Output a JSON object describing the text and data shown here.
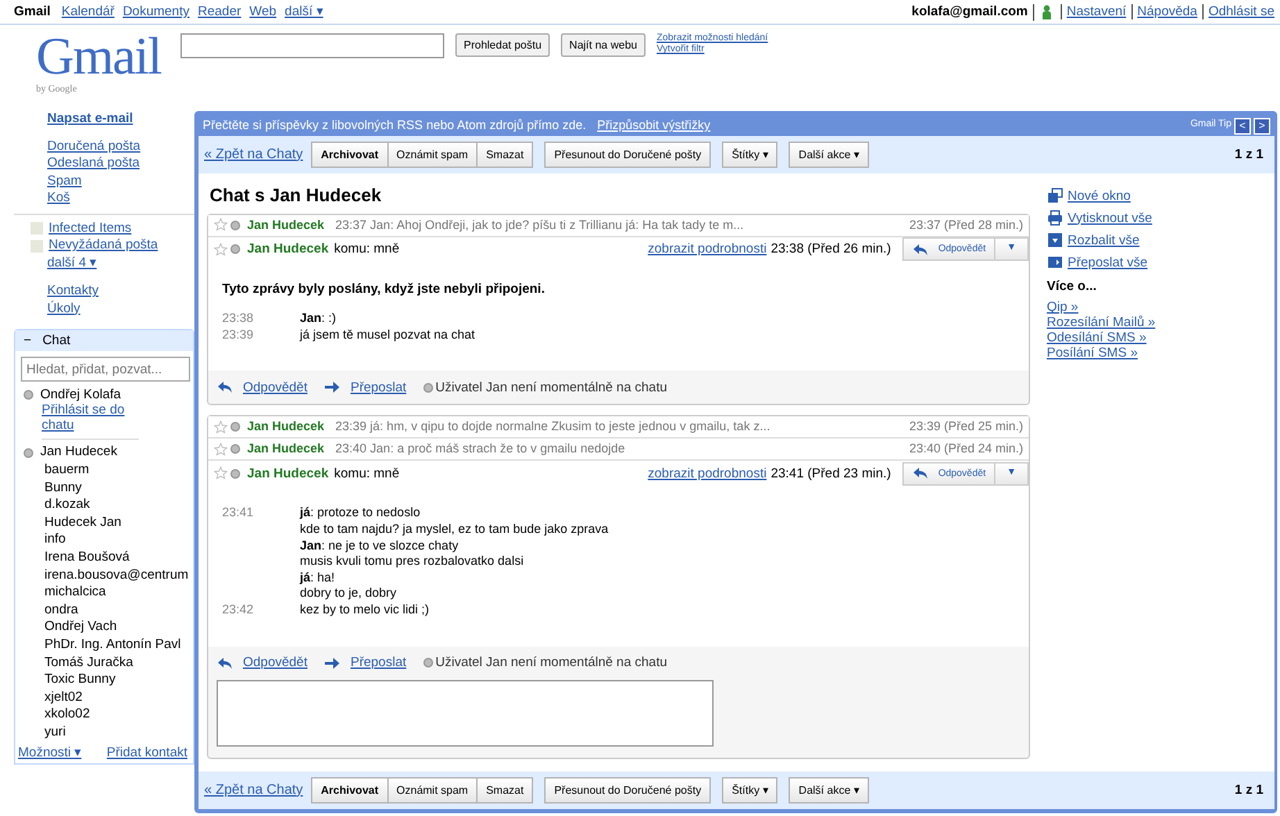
{
  "top_nav": {
    "links": [
      {
        "label": "Gmail",
        "selected": true
      },
      {
        "label": "Kalendář",
        "selected": false
      },
      {
        "label": "Dokumenty",
        "selected": false
      },
      {
        "label": "Reader",
        "selected": false
      },
      {
        "label": "Web",
        "selected": false
      },
      {
        "label": "další ▾",
        "selected": false
      }
    ],
    "account": "kolafa@gmail.com",
    "user_links": [
      "Nastavení",
      "Nápověda",
      "Odhlásit se"
    ]
  },
  "header": {
    "logo": "Gmail",
    "logo_sub": "by Google",
    "search_buttons": [
      "Prohledat poštu",
      "Najít na webu"
    ],
    "search_links": [
      "Zobrazit možnosti hledání",
      "Vytvořit filtr"
    ]
  },
  "sidebar": {
    "compose": "Napsat e-mail",
    "folders": [
      {
        "label": "Doručená pošta"
      },
      {
        "label": "Odeslaná pošta"
      },
      {
        "label": "Spam"
      },
      {
        "label": "Koš"
      }
    ],
    "labels": [
      {
        "label": "Infected Items"
      },
      {
        "label": "Nevyžádaná pošta"
      }
    ],
    "more": "další 4 ▾",
    "links": [
      "Kontakty",
      "Úkoly"
    ],
    "chat": {
      "toggle": "−",
      "title": "Chat",
      "expanded": true,
      "placeholder": "Hledat, přidat, pozvat...",
      "me": "Ondřej Kolafa",
      "sign_in": "Přihlásit se do chatu",
      "contacts": [
        {
          "name": "Jan Hudecek",
          "online": false
        },
        {
          "name": "bauerm"
        },
        {
          "name": "Bunny"
        },
        {
          "name": "d.kozak"
        },
        {
          "name": "Hudecek Jan"
        },
        {
          "name": "info"
        },
        {
          "name": "Irena Boušová"
        },
        {
          "name": "irena.bousova@centrum"
        },
        {
          "name": "michalcica"
        },
        {
          "name": "ondra"
        },
        {
          "name": "Ondřej Vach"
        },
        {
          "name": "PhDr. Ing. Antonín Pavl"
        },
        {
          "name": "Tomáš Juračka"
        },
        {
          "name": "Toxic Bunny"
        },
        {
          "name": "xjelt02"
        },
        {
          "name": "xkolo02"
        },
        {
          "name": "yuri"
        }
      ],
      "options": "Možnosti ▾",
      "add_contact": "Přidat kontakt"
    }
  },
  "tip_bar": {
    "text": "Přečtěte si příspěvky z libovolných RSS nebo Atom zdrojů přímo zde.",
    "link": "Přizpůsobit výstřižky",
    "tip_label": "Gmail Tip",
    "prev": "<",
    "next": ">"
  },
  "toolbar_top": {
    "back": "« Zpět na Chaty",
    "groups": [
      [
        {
          "label": "Archivovat",
          "bold": true
        },
        {
          "label": "Oznámit spam",
          "bold": false
        },
        {
          "label": "Smazat",
          "bold": false
        }
      ],
      [
        {
          "label": "Přesunout do Doručené pošty",
          "bold": false
        }
      ],
      [
        {
          "label": "Štítky ▾",
          "bold": false
        }
      ],
      [
        {
          "label": "Další akce ▾",
          "bold": false
        }
      ]
    ],
    "count": "1 z 1"
  },
  "conversation_title": "Chat s Jan Hudecek",
  "threads": [
    {
      "messages": [
        {
          "kind": "collapsed",
          "starred": false,
          "sender": "Jan Hudecek",
          "snippet": "23:37 Jan: Ahoj Ondřeji, jak to jde? píšu ti z Trillianu já: Ha tak tady te m...",
          "date": "23:37 (Před 28 min.)"
        },
        {
          "kind": "expanded",
          "starred": false,
          "sender": "Jan Hudecek",
          "to": "komu: mně",
          "details": "zobrazit podrobnosti",
          "date": "23:38 (Před 26 min.)",
          "reply": "Odpovědět",
          "menu": "▼",
          "notice": "Tyto zprávy byly poslány, když jste nebyli připojeni.",
          "lines": [
            {
              "time": "23:38",
              "text": "**Jan**: :)"
            },
            {
              "time": "23:39",
              "text": "já jsem tě musel pozvat na chat"
            }
          ]
        }
      ],
      "footer": {
        "reply": "Odpovědět",
        "forward": "Přeposlat",
        "status": "Uživatel Jan není momentálně na chatu"
      },
      "reply_box": false
    },
    {
      "messages": [
        {
          "kind": "collapsed",
          "starred": false,
          "sender": "Jan Hudecek",
          "snippet": "23:39 já: hm, v qipu to dojde normalne Zkusim to jeste jednou v gmailu, tak z...",
          "date": "23:39 (Před 25 min.)"
        },
        {
          "kind": "collapsed",
          "starred": false,
          "sender": "Jan Hudecek",
          "snippet": "23:40 Jan: a proč máš strach že to v gmailu nedojde",
          "date": "23:40 (Před 24 min.)"
        },
        {
          "kind": "expanded",
          "starred": false,
          "sender": "Jan Hudecek",
          "to": "komu: mně",
          "details": "zobrazit podrobnosti",
          "date": "23:41 (Před 23 min.)",
          "reply": "Odpovědět",
          "menu": "▼",
          "lines": [
            {
              "time": "23:41",
              "text": "**já**: protoze to nedoslo"
            },
            {
              "text": "kde to tam najdu? ja myslel, ez to tam bude jako zprava"
            },
            {
              "text": "**Jan**: ne je to ve slozce chaty"
            },
            {
              "text": "musis kvuli tomu pres rozbalovatko dalsi"
            },
            {
              "text": "**já**: ha!"
            },
            {
              "text": "dobry to je, dobry"
            },
            {
              "time": "23:42",
              "text": "kez by to melo vic lidi ;)"
            }
          ]
        }
      ],
      "footer": {
        "reply": "Odpovědět",
        "forward": "Přeposlat",
        "status": "Uživatel Jan není momentálně na chatu"
      },
      "reply_box": true
    }
  ],
  "side_actions": [
    "Nové okno",
    "Vytisknout vše",
    "Rozbalit vše",
    "Přeposlat vše"
  ],
  "more_about": {
    "title": "Více o...",
    "links": [
      "Qip »",
      "Rozesílání Mailů »",
      "Odesílání SMS »",
      "Posílání SMS »"
    ]
  },
  "toolbar_bottom": {
    "back": "« Zpět na Chaty",
    "groups": [
      [
        {
          "label": "Archivovat",
          "bold": true
        },
        {
          "label": "Oznámit spam",
          "bold": false
        },
        {
          "label": "Smazat",
          "bold": false
        }
      ],
      [
        {
          "label": "Přesunout do Doručené pošty",
          "bold": false
        }
      ],
      [
        {
          "label": "Štítky ▾",
          "bold": false
        }
      ],
      [
        {
          "label": "Další akce ▾",
          "bold": false
        }
      ]
    ],
    "count": "1 z 1"
  }
}
